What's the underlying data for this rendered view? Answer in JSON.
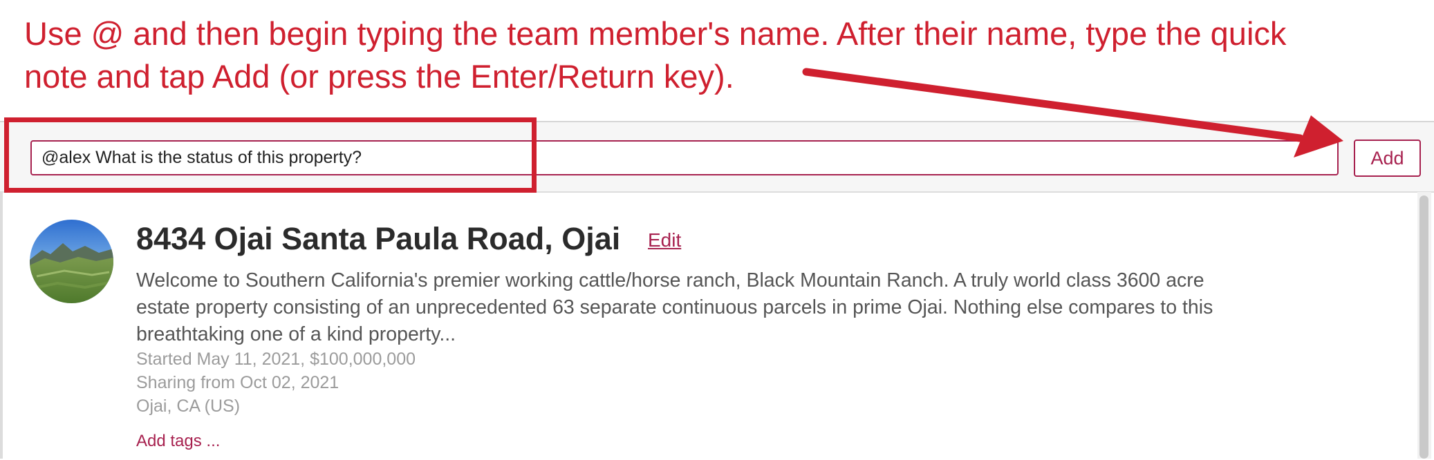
{
  "annotation": {
    "line1": "Use @ and then begin typing the team member's name. After their name, type the quick",
    "line2": "note and tap Add (or press the Enter/Return key).",
    "color": "#cf202f"
  },
  "quick_note": {
    "input_value": "@alex What is the status of this property?",
    "add_label": "Add"
  },
  "property": {
    "title": "8434 Ojai Santa Paula Road, Ojai",
    "edit_label": "Edit",
    "description_lines": [
      "Welcome to Southern California's premier working cattle/horse ranch, Black Mountain Ranch. A truly world class 3600 acre",
      "estate property consisting of an unprecedented 63 separate continuous parcels in prime Ojai. Nothing else compares to this",
      "breathtaking one of a kind property..."
    ],
    "started": "Started May 11, 2021, $100,000,000",
    "sharing": "Sharing from Oct 02, 2021",
    "location": "Ojai, CA (US)",
    "add_tags_label": "Add tags ..."
  },
  "colors": {
    "accent": "#a7214f",
    "annotation_red": "#cf202f",
    "title_text": "#2b2b2b",
    "body_text": "#555555",
    "meta_text": "#9b9b9b"
  }
}
